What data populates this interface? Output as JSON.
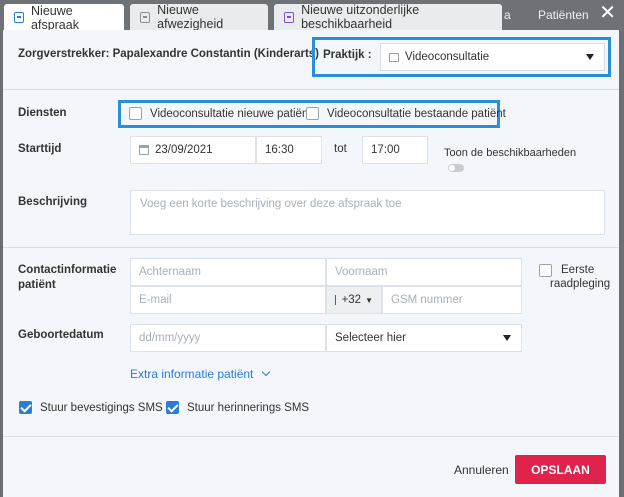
{
  "tabs": [
    {
      "label": "Nieuwe afspraak",
      "icon": "calendar-plus-icon"
    },
    {
      "label": "Nieuwe afwezigheid",
      "icon": "calendar-minus-icon"
    },
    {
      "label": "Nieuwe uitzonderlijke beschikbaarheid",
      "icon": "calendar-icon"
    }
  ],
  "background_tabs": {
    "fragment": "a",
    "patients": "Patiënten"
  },
  "header": {
    "provider": "Zorgverstrekker: Papalexandre Constantin (Kinderarts)",
    "practice_label": "Praktijk :",
    "practice_value": "Videoconsultatie"
  },
  "services": {
    "label": "Diensten",
    "options": [
      {
        "label": "Videoconsultatie nieuwe patiënt",
        "checked": false
      },
      {
        "label": "Videoconsultatie bestaande patiënt",
        "checked": false
      }
    ]
  },
  "start": {
    "label": "Starttijd",
    "date": "23/09/2021",
    "time_from": "16:30",
    "to_label": "tot",
    "time_to": "17:00",
    "availability_toggle_label": "Toon de beschikbaarheden",
    "availability_toggle_on": false
  },
  "description": {
    "label": "Beschrijving",
    "placeholder": "Voeg een korte beschrijving over deze afspraak toe"
  },
  "contact": {
    "label_line1": "Contactinformatie",
    "label_line2": "patiënt",
    "lastname_placeholder": "Achternaam",
    "firstname_placeholder": "Voornaam",
    "email_placeholder": "E-mail",
    "phone_prefix": "+32",
    "phone_placeholder": "GSM nummer",
    "first_visit_label_line1": "Eerste",
    "first_visit_label_line2": "raadpleging",
    "first_visit_checked": false
  },
  "birthdate": {
    "label": "Geboortedatum",
    "placeholder": "dd/mm/yyyy",
    "select_value": "Selecteer hier"
  },
  "extra_link": "Extra informatie patiënt",
  "sms": {
    "confirm_label": "Stuur bevestigings SMS",
    "confirm_checked": true,
    "reminder_label": "Stuur herinnerings SMS",
    "reminder_checked": true
  },
  "footer": {
    "cancel_label": "Annuleren",
    "save_label": "OPSLAAN"
  },
  "colors": {
    "accent": "#2b7cd3",
    "save": "#e0234c",
    "highlight": "#2a8fd6"
  }
}
